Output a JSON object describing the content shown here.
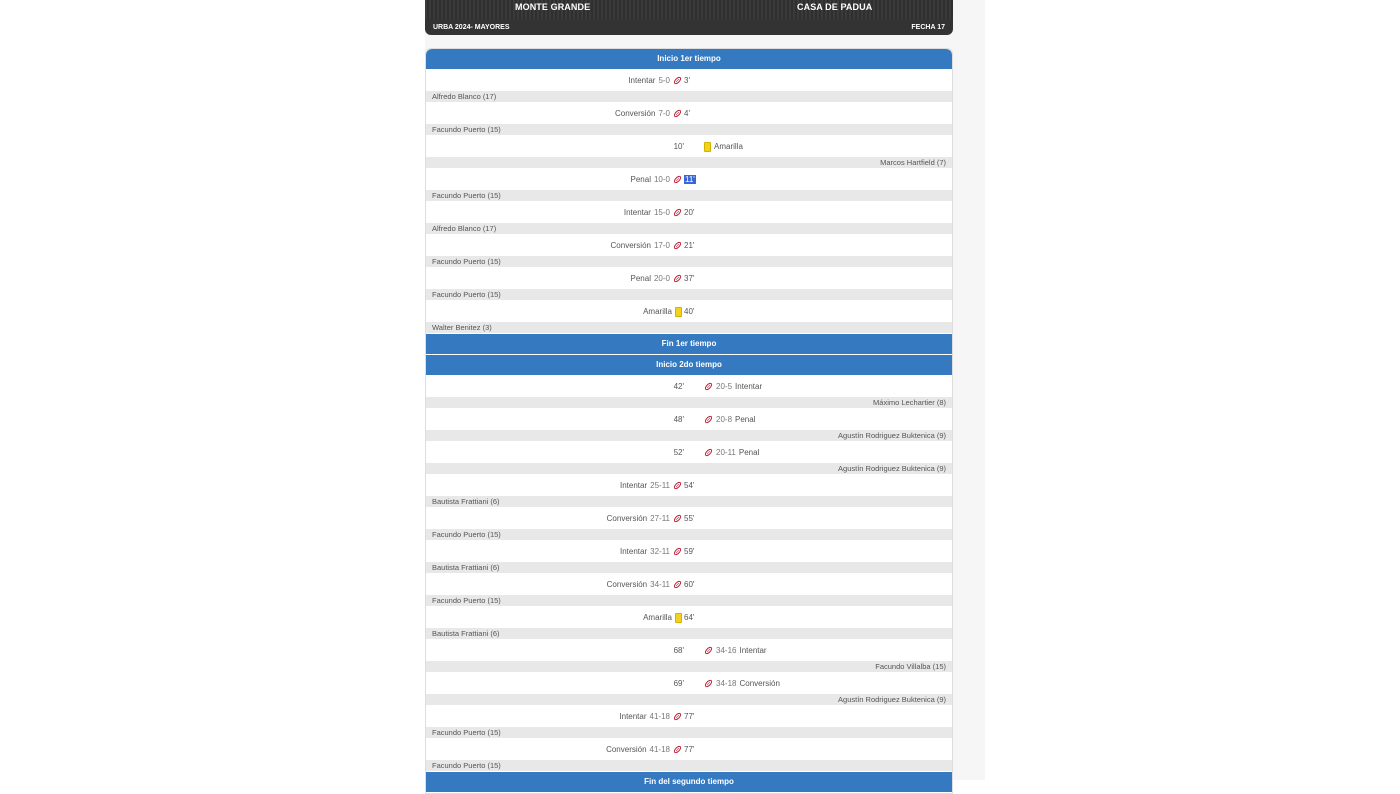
{
  "header": {
    "home_team": "MONTE GRANDE",
    "away_team": "CASA DE PADUA",
    "tournament": "URBA 2024- MAYORES",
    "round": "FECHA 17"
  },
  "sections": {
    "start_first": "Inicio 1er tiempo",
    "end_first": "Fin 1er tiempo",
    "start_second": "Inicio 2do tiempo",
    "end_second": "Fin del segundo tiempo"
  },
  "first_half": [
    {
      "side": "home",
      "type": "Intentar",
      "score": "5-0",
      "minute": "3'",
      "player": "Alfredo Blanco (17)",
      "icon": "rugby-ball-icon"
    },
    {
      "side": "home",
      "type": "Conversión",
      "score": "7-0",
      "minute": "4'",
      "player": "Facundo Puerto (15)",
      "icon": "rugby-ball-icon"
    },
    {
      "side": "away",
      "type": "Amarilla",
      "score": "",
      "minute": "10'",
      "player": "Marcos Hartfield (7)",
      "icon": "yellow-card-icon"
    },
    {
      "side": "home",
      "type": "Penal",
      "score": "10-0",
      "minute": "11'",
      "player": "Facundo Puerto (15)",
      "icon": "rugby-ball-icon",
      "highlight": true
    },
    {
      "side": "home",
      "type": "Intentar",
      "score": "15-0",
      "minute": "20'",
      "player": "Alfredo Blanco (17)",
      "icon": "rugby-ball-icon"
    },
    {
      "side": "home",
      "type": "Conversión",
      "score": "17-0",
      "minute": "21'",
      "player": "Facundo Puerto (15)",
      "icon": "rugby-ball-icon"
    },
    {
      "side": "home",
      "type": "Penal",
      "score": "20-0",
      "minute": "37'",
      "player": "Facundo Puerto (15)",
      "icon": "rugby-ball-icon"
    },
    {
      "side": "home",
      "type": "Amarilla",
      "score": "",
      "minute": "40'",
      "player": "Walter Benitez (3)",
      "icon": "yellow-card-icon"
    }
  ],
  "second_half": [
    {
      "side": "away",
      "type": "Intentar",
      "score": "20-5",
      "minute": "42'",
      "player": "Máximo Lechartier (8)",
      "icon": "rugby-ball-icon"
    },
    {
      "side": "away",
      "type": "Penal",
      "score": "20-8",
      "minute": "48'",
      "player": "Agustín Rodriguez Buktenica (9)",
      "icon": "rugby-ball-icon"
    },
    {
      "side": "away",
      "type": "Penal",
      "score": "20-11",
      "minute": "52'",
      "player": "Agustín Rodriguez Buktenica (9)",
      "icon": "rugby-ball-icon"
    },
    {
      "side": "home",
      "type": "Intentar",
      "score": "25-11",
      "minute": "54'",
      "player": "Bautista Frattiani (6)",
      "icon": "rugby-ball-icon"
    },
    {
      "side": "home",
      "type": "Conversión",
      "score": "27-11",
      "minute": "55'",
      "player": "Facundo Puerto (15)",
      "icon": "rugby-ball-icon"
    },
    {
      "side": "home",
      "type": "Intentar",
      "score": "32-11",
      "minute": "59'",
      "player": "Bautista Frattiani (6)",
      "icon": "rugby-ball-icon"
    },
    {
      "side": "home",
      "type": "Conversión",
      "score": "34-11",
      "minute": "60'",
      "player": "Facundo Puerto (15)",
      "icon": "rugby-ball-icon"
    },
    {
      "side": "home",
      "type": "Amarilla",
      "score": "",
      "minute": "64'",
      "player": "Bautista Frattiani (6)",
      "icon": "yellow-card-icon"
    },
    {
      "side": "away",
      "type": "Intentar",
      "score": "34-16",
      "minute": "68'",
      "player": "Facundo Villalba (15)",
      "icon": "rugby-ball-icon"
    },
    {
      "side": "away",
      "type": "Conversión",
      "score": "34-18",
      "minute": "69'",
      "player": "Agustín Rodriguez Buktenica (9)",
      "icon": "rugby-ball-icon"
    },
    {
      "side": "home",
      "type": "Intentar",
      "score": "41-18",
      "minute": "77'",
      "player": "Facundo Puerto (15)",
      "icon": "rugby-ball-icon"
    },
    {
      "side": "home",
      "type": "Conversión",
      "score": "41-18",
      "minute": "77'",
      "player": "Facundo Puerto (15)",
      "icon": "rugby-ball-icon"
    }
  ],
  "colors": {
    "section_blue": "#3579c0",
    "header_dark": "#333333",
    "yellow_card": "#f2d21c",
    "ball_red": "#c0203a"
  }
}
